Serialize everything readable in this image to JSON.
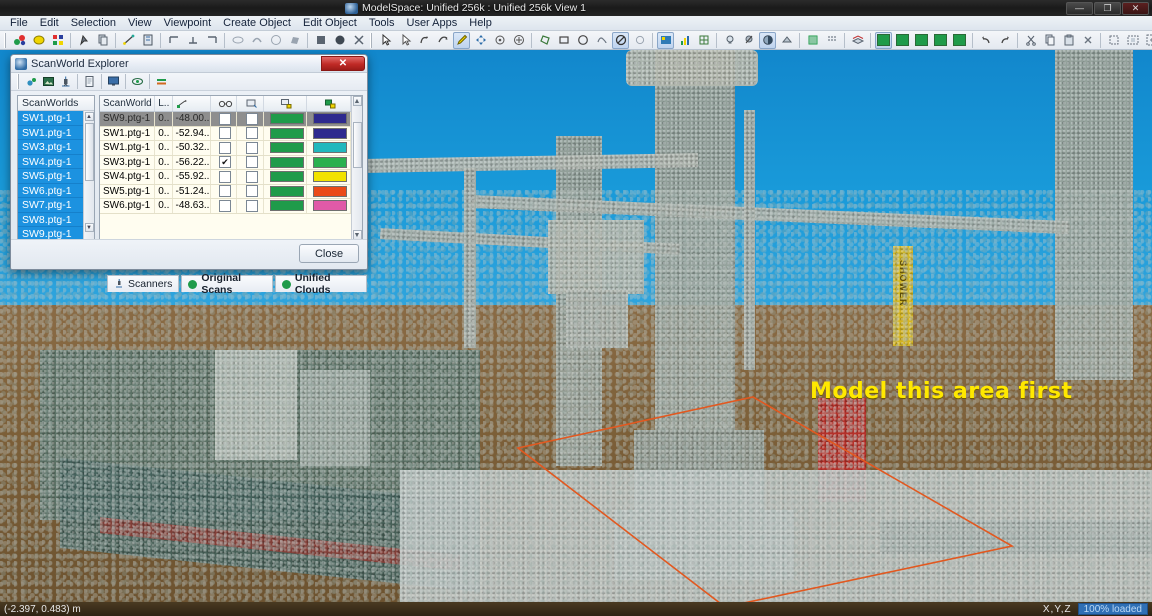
{
  "window": {
    "title": "ModelSpace: Unified 256k : Unified 256k View 1",
    "minimize_label": "—",
    "maximize_label": "❐",
    "close_label": "✕"
  },
  "menubar": {
    "items": [
      {
        "label": "File"
      },
      {
        "label": "Edit"
      },
      {
        "label": "Selection"
      },
      {
        "label": "View"
      },
      {
        "label": "Viewpoint"
      },
      {
        "label": "Create Object"
      },
      {
        "label": "Edit Object"
      },
      {
        "label": "Tools"
      },
      {
        "label": "User Apps"
      },
      {
        "label": "Help"
      }
    ]
  },
  "toolbar": {
    "groups": [
      {
        "icons": [
          "color-points-icon",
          "highlight-icon",
          "multi-color-icon"
        ]
      },
      {
        "icons": [
          "pick-icon",
          "copy-icon",
          "measure-icon",
          "register-icon"
        ]
      },
      {
        "icons": [
          "align-left-icon",
          "align-bottom-icon",
          "align-right-icon"
        ]
      },
      {
        "icons": [
          "cylinder-icon",
          "pipe-icon",
          "circle-icon",
          "patch-icon"
        ]
      },
      {
        "icons": [
          "square-solid-icon",
          "circle-solid-icon",
          "delete-x-icon"
        ]
      },
      {
        "icons": [
          "pointer-icon",
          "select-arrow-icon",
          "rotate-icon",
          "orbit-icon",
          "pencil-icon",
          "pan-icon",
          "zoom-icon",
          "zoom-window-icon"
        ]
      },
      {
        "icons": [
          "fence-polygon-icon",
          "fence-rect-icon",
          "fence-circle-icon",
          "fence-free-icon",
          "no-fence-icon",
          "fence-off-icon"
        ]
      },
      {
        "icons": [
          "render-points-icon",
          "render-bars-icon",
          "render-grid-icon"
        ]
      },
      {
        "icons": [
          "light-icon",
          "light-off-icon",
          "shade-icon",
          "flat-icon"
        ]
      },
      {
        "icons": [
          "texture-icon",
          "grid-snap-icon",
          "grid-dots-icon"
        ]
      },
      {
        "icons": [
          "layer-icon"
        ]
      },
      {
        "icons": [
          "swatch-1",
          "swatch-2",
          "swatch-3",
          "swatch-4",
          "swatch-5"
        ]
      },
      {
        "icons": [
          "undo-icon",
          "redo-icon"
        ]
      },
      {
        "icons": [
          "cut-icon",
          "copy-clip-icon",
          "paste-icon",
          "delete-icon"
        ]
      },
      {
        "icons": [
          "fit-icon",
          "fit-window-icon",
          "fit-all-icon"
        ]
      }
    ],
    "swatch_colors": [
      "#1f9b4a",
      "#1f9b4a",
      "#1f9b4a",
      "#1f9b4a",
      "#1f9b4a"
    ]
  },
  "scanworld_explorer": {
    "title": "ScanWorld Explorer",
    "close_box_label": "✕",
    "toolbar_icons": [
      "points-icon",
      "image-icon",
      "scanner-icon",
      "document-icon",
      "monitor-icon",
      "view-icon",
      "layers-icon"
    ],
    "list_panel": {
      "header": "ScanWorlds",
      "items": [
        {
          "label": "SW1.ptg-1"
        },
        {
          "label": "SW1.ptg-1"
        },
        {
          "label": "SW3.ptg-1"
        },
        {
          "label": "SW4.ptg-1"
        },
        {
          "label": "SW5.ptg-1"
        },
        {
          "label": "SW6.ptg-1"
        },
        {
          "label": "SW7.ptg-1"
        },
        {
          "label": "SW8.ptg-1"
        },
        {
          "label": "SW9.ptg-1"
        }
      ]
    },
    "grid": {
      "headers": [
        {
          "label": "ScanWorld",
          "icon": ""
        },
        {
          "label": "L..",
          "icon": ""
        },
        {
          "label": "",
          "icon": "ruler-icon"
        },
        {
          "label": "",
          "icon": "binocular-icon"
        },
        {
          "label": "",
          "icon": "view-lock-icon"
        },
        {
          "label": "",
          "icon": "color-key-icon"
        },
        {
          "label": "",
          "icon": "color-map-icon"
        }
      ],
      "rows": [
        {
          "name": "SW9.ptg-1",
          "l": "0..",
          "value": "-48.00..",
          "check1": false,
          "check2": false,
          "color1": "#1f9b4a",
          "color2": "#2e2a8e",
          "selected": true
        },
        {
          "name": "SW1.ptg-1",
          "l": "0..",
          "value": "-52.94..",
          "check1": false,
          "check2": false,
          "color1": "#1f9b4a",
          "color2": "#2e2a8e",
          "selected": false
        },
        {
          "name": "SW1.ptg-1",
          "l": "0..",
          "value": "-50.32..",
          "check1": false,
          "check2": false,
          "color1": "#1f9b4a",
          "color2": "#21b8bd",
          "selected": false
        },
        {
          "name": "SW3.ptg-1",
          "l": "0..",
          "value": "-56.22..",
          "check1": true,
          "check2": false,
          "color1": "#1f9b4a",
          "color2": "#2ab04e",
          "selected": false
        },
        {
          "name": "SW4.ptg-1",
          "l": "0..",
          "value": "-55.92..",
          "check1": false,
          "check2": false,
          "color1": "#1f9b4a",
          "color2": "#f2e200",
          "selected": false
        },
        {
          "name": "SW5.ptg-1",
          "l": "0..",
          "value": "-51.24..",
          "check1": false,
          "check2": false,
          "color1": "#1f9b4a",
          "color2": "#ea4a18",
          "selected": false
        },
        {
          "name": "SW6.ptg-1",
          "l": "0..",
          "value": "-48.63..",
          "check1": false,
          "check2": false,
          "color1": "#1f9b4a",
          "color2": "#e05aa8",
          "selected": false
        }
      ],
      "checkmark": "✔"
    },
    "tabs": [
      {
        "label": "Scanners",
        "icon": "scanner-icon",
        "bold": false
      },
      {
        "label": "Original Scans",
        "icon": "scan-icon",
        "bold": true
      },
      {
        "label": "Unified Clouds",
        "icon": "cloud-icon",
        "bold": true
      }
    ],
    "close_button": "Close"
  },
  "viewport": {
    "annotation": "Model this area first",
    "annotation_color": "#ffe800",
    "selection_color": "#e2581f",
    "sky_color": "#1b8fd0",
    "ground_color": "#7d6039",
    "sign_text": "SHOWER"
  },
  "statusbar": {
    "coordinates": "(-2.397, 0.483) m",
    "axis_label": "X,Y,Z",
    "load_status": "100% loaded"
  }
}
